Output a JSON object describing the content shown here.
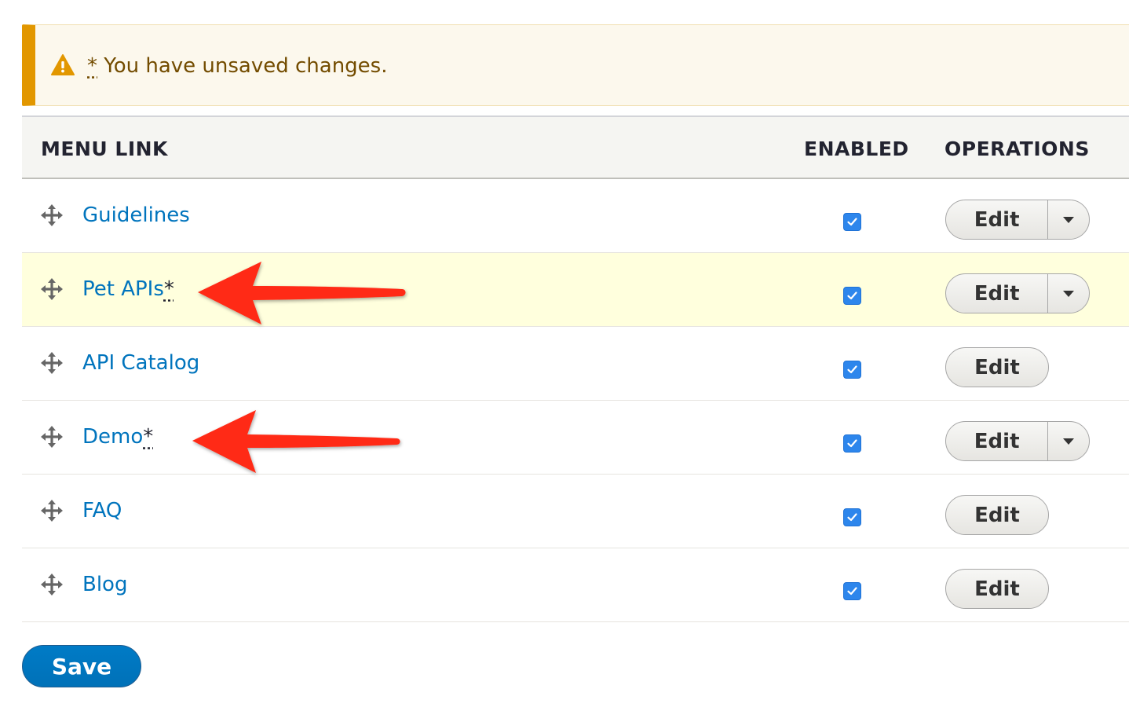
{
  "message": {
    "marker": "*",
    "text": " You have unsaved changes.",
    "icon": "warning-icon",
    "accent": "#e29700"
  },
  "table": {
    "headers": {
      "menu_link": "MENU LINK",
      "enabled": "ENABLED",
      "operations": "OPERATIONS"
    },
    "rows": [
      {
        "title": "Guidelines",
        "changed_marker": "",
        "enabled": true,
        "operation": "Edit",
        "has_dropdown": true,
        "highlighted": false
      },
      {
        "title": "Pet APIs",
        "changed_marker": "*",
        "enabled": true,
        "operation": "Edit",
        "has_dropdown": true,
        "highlighted": true
      },
      {
        "title": "API Catalog",
        "changed_marker": "",
        "enabled": true,
        "operation": "Edit",
        "has_dropdown": false,
        "highlighted": false
      },
      {
        "title": "Demo",
        "changed_marker": "*",
        "enabled": true,
        "operation": "Edit",
        "has_dropdown": true,
        "highlighted": false
      },
      {
        "title": "FAQ",
        "changed_marker": "",
        "enabled": true,
        "operation": "Edit",
        "has_dropdown": false,
        "highlighted": false
      },
      {
        "title": "Blog",
        "changed_marker": "",
        "enabled": true,
        "operation": "Edit",
        "has_dropdown": false,
        "highlighted": false
      }
    ]
  },
  "actions": {
    "save_label": "Save"
  },
  "colors": {
    "link": "#0074bd",
    "checkbox": "#2d86ec",
    "highlight_row": "#ffffdd",
    "save_button": "#0071b8",
    "annotation_arrow": "#ff2a14"
  }
}
